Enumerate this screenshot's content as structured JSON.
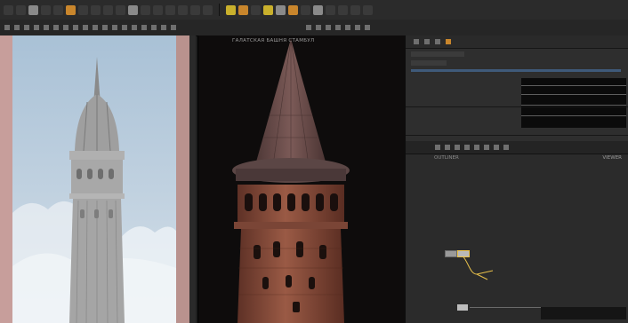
{
  "app": {
    "menu_items": [
      "",
      "",
      ""
    ]
  },
  "viewport": {
    "label": "ГАЛАТСКАЯ БАШНЯ СТАМБУЛ"
  },
  "node_editor": {
    "title": "VIEWER",
    "label": "OUTLINER"
  },
  "colors": {
    "accent_orange": "#c9862c",
    "accent_yellow": "#e8c04a",
    "sky": "#a9c1d6",
    "tower_roof": "#6a4d4a",
    "tower_brick": "#8a4d3c"
  }
}
